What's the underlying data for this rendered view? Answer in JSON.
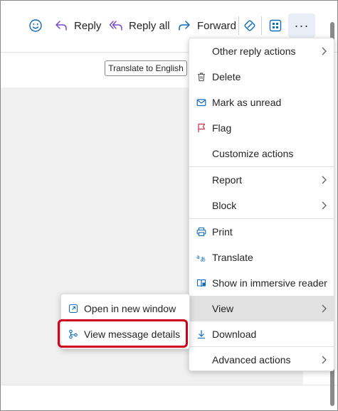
{
  "toolbar": {
    "reply_label": "Reply",
    "reply_all_label": "Reply all",
    "forward_label": "Forward",
    "more_label": "···"
  },
  "subbar": {
    "translate_label": "Translate to English"
  },
  "menu": {
    "items": [
      {
        "label": "Other reply actions",
        "icon": "none",
        "submenu": true
      },
      {
        "label": "Delete",
        "icon": "trash-icon"
      },
      {
        "label": "Mark as unread",
        "icon": "envelope-icon"
      },
      {
        "label": "Flag",
        "icon": "flag-icon"
      },
      {
        "label": "Customize actions",
        "icon": "none"
      },
      {
        "label": "Report",
        "icon": "none",
        "submenu": true
      },
      {
        "label": "Block",
        "icon": "none",
        "submenu": true
      },
      {
        "label": "Print",
        "icon": "printer-icon"
      },
      {
        "label": "Translate",
        "icon": "translate-icon"
      },
      {
        "label": "Show in immersive reader",
        "icon": "immersive-reader-icon"
      },
      {
        "label": "View",
        "icon": "none",
        "submenu": true,
        "active": true
      },
      {
        "label": "Download",
        "icon": "download-icon"
      },
      {
        "label": "Advanced actions",
        "icon": "none",
        "submenu": true
      }
    ]
  },
  "submenu": {
    "items": [
      {
        "label": "Open in new window",
        "icon": "open-new-window-icon"
      },
      {
        "label": "View message details",
        "icon": "message-details-icon",
        "highlighted": true
      }
    ]
  },
  "colors": {
    "accent": "#0f6cbd",
    "reply_purple": "#7a4bc9",
    "flag_red": "#c4314b",
    "highlight_red": "#d0021b"
  }
}
